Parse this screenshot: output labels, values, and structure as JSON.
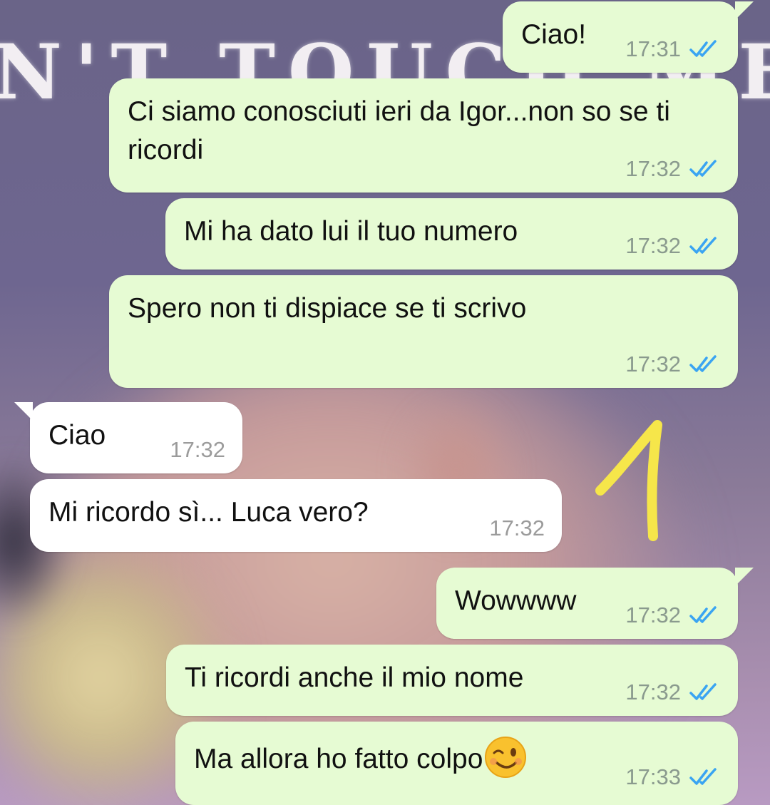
{
  "background": {
    "overlay_text": "N'T TOUCH ME"
  },
  "annotation": {
    "number": "1",
    "color": "#f6e64a"
  },
  "colors": {
    "outgoing_bubble": "#e6fbd3",
    "incoming_bubble": "#ffffff",
    "read_ticks": "#3aa4f2"
  },
  "messages": [
    {
      "direction": "outgoing",
      "text": "Ciao!",
      "time": "17:31",
      "status": "read"
    },
    {
      "direction": "outgoing",
      "text": "Ci siamo conosciuti ieri da Igor...non so se ti ricordi",
      "time": "17:32",
      "status": "read"
    },
    {
      "direction": "outgoing",
      "text": "Mi ha dato lui il tuo numero",
      "time": "17:32",
      "status": "read"
    },
    {
      "direction": "outgoing",
      "text": "Spero non ti dispiace se ti scrivo",
      "time": "17:32",
      "status": "read"
    },
    {
      "direction": "incoming",
      "text": "Ciao",
      "time": "17:32"
    },
    {
      "direction": "incoming",
      "text": "Mi ricordo sì... Luca vero?",
      "time": "17:32"
    },
    {
      "direction": "outgoing",
      "text": "Wowwww",
      "time": "17:32",
      "status": "read"
    },
    {
      "direction": "outgoing",
      "text": "Ti ricordi anche il mio nome",
      "time": "17:32",
      "status": "read"
    },
    {
      "direction": "outgoing",
      "text": "Ma allora ho fatto colpo",
      "emoji": "winking-face-emoji",
      "time": "17:33",
      "status": "read"
    }
  ]
}
